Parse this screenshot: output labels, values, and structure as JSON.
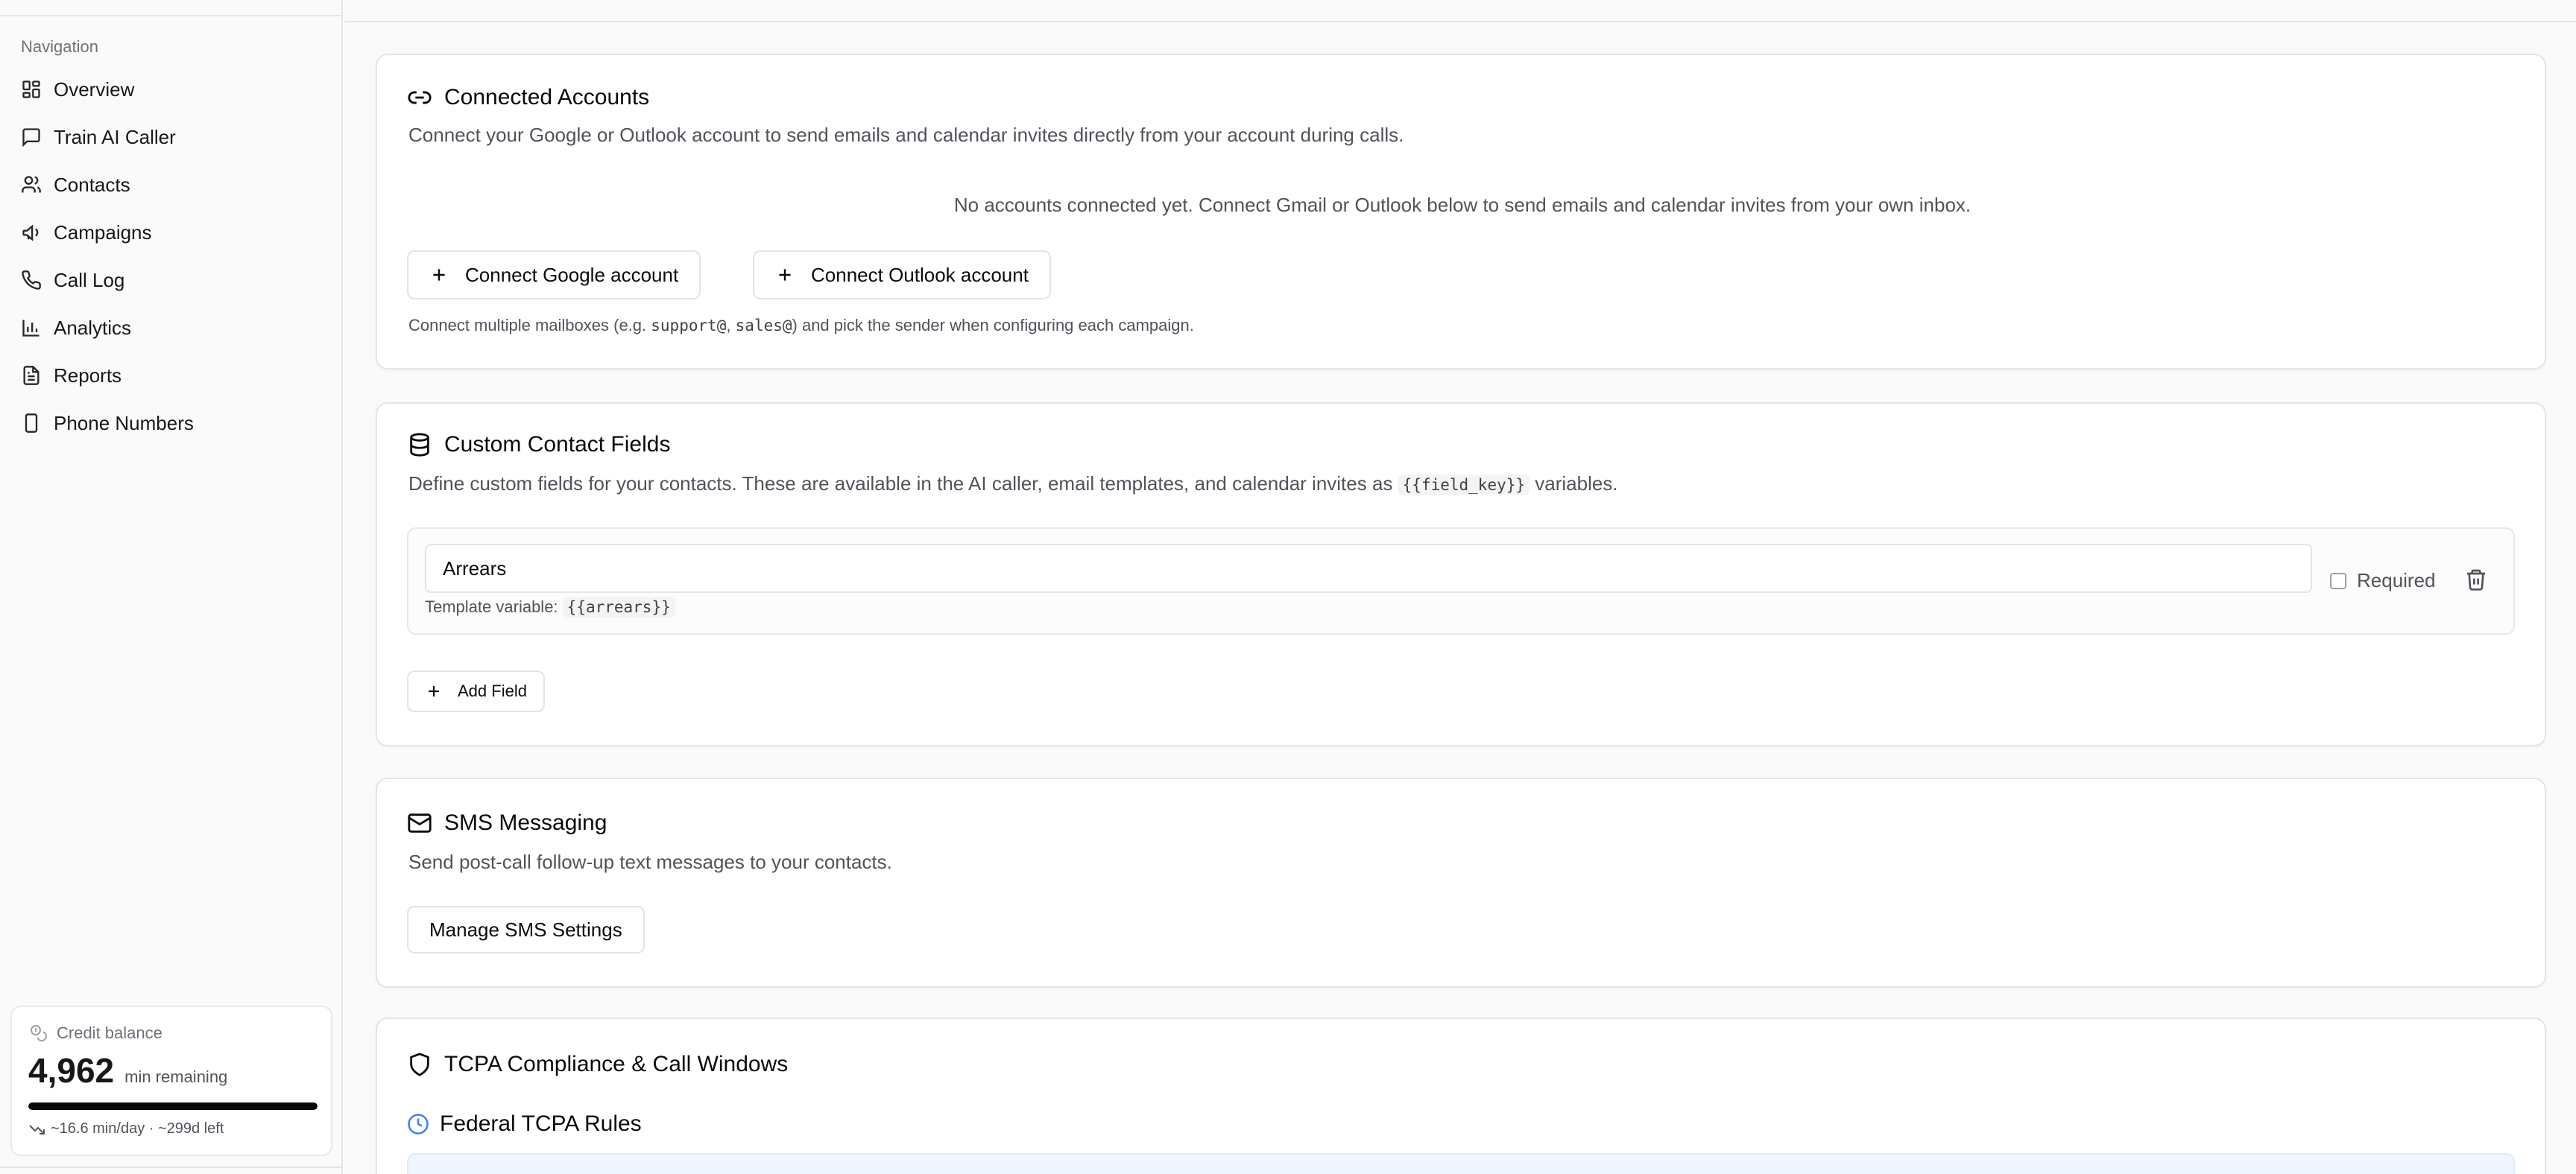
{
  "sidebar": {
    "heading": "Navigation",
    "items": [
      {
        "label": "Overview",
        "icon": "dashboard-icon"
      },
      {
        "label": "Train AI Caller",
        "icon": "message-square-icon"
      },
      {
        "label": "Contacts",
        "icon": "users-icon"
      },
      {
        "label": "Campaigns",
        "icon": "megaphone-icon"
      },
      {
        "label": "Call Log",
        "icon": "phone-icon"
      },
      {
        "label": "Analytics",
        "icon": "bar-chart-icon"
      },
      {
        "label": "Reports",
        "icon": "file-text-icon"
      },
      {
        "label": "Phone Numbers",
        "icon": "smartphone-icon"
      }
    ],
    "credit": {
      "label": "Credit balance",
      "value": "4,962",
      "unit": "min remaining",
      "progress_fraction": 1.0,
      "rate": "~16.6 min/day · ~299d left"
    }
  },
  "connected_accounts": {
    "title": "Connected Accounts",
    "description": "Connect your Google or Outlook account to send emails and calendar invites directly from your account during calls.",
    "empty_state": "No accounts connected yet. Connect Gmail or Outlook below to send emails and calendar invites from your own inbox.",
    "google_button": "Connect Google account",
    "outlook_button": "Connect Outlook account",
    "hint_prefix": "Connect multiple mailboxes (e.g. ",
    "hint_code_1": "support@",
    "hint_sep": ", ",
    "hint_code_2": "sales@",
    "hint_suffix": ") and pick the sender when configuring each campaign."
  },
  "custom_fields": {
    "title": "Custom Contact Fields",
    "description_prefix": "Define custom fields for your contacts. These are available in the AI caller, email templates, and calendar invites as ",
    "description_code": "{{field_key}}",
    "description_suffix": " variables.",
    "fields": [
      {
        "name": "Arrears",
        "template_label": "Template variable: ",
        "template_var": "{{arrears}}",
        "required_label": "Required",
        "required": false
      }
    ],
    "add_button": "Add Field"
  },
  "sms": {
    "title": "SMS Messaging",
    "description": "Send post-call follow-up text messages to your contacts.",
    "button": "Manage SMS Settings"
  },
  "tcpa": {
    "title": "TCPA Compliance & Call Windows",
    "subtitle": "Federal TCPA Rules"
  },
  "colors": {
    "accent_blue": "#3b82f6",
    "border": "#e5e5e5",
    "muted_text": "#52525b"
  }
}
